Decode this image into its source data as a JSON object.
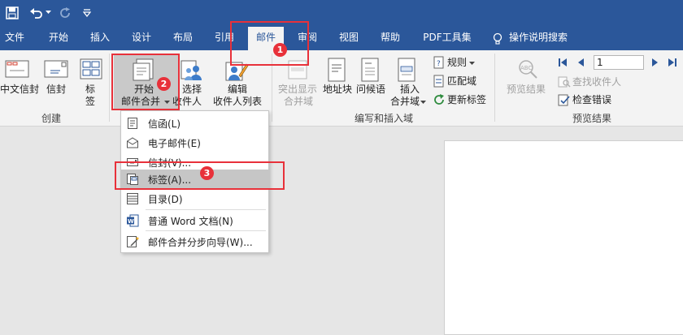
{
  "colors": {
    "brand": "#2b579a",
    "ribbon_bg": "#f3f3f3",
    "highlight": "#c6c6c6",
    "annotation_red": "#e8313a"
  },
  "tabs": [
    {
      "label": "文件"
    },
    {
      "label": "开始"
    },
    {
      "label": "插入"
    },
    {
      "label": "设计"
    },
    {
      "label": "布局"
    },
    {
      "label": "引用"
    },
    {
      "label": "邮件"
    },
    {
      "label": "审阅"
    },
    {
      "label": "视图"
    },
    {
      "label": "帮助"
    },
    {
      "label": "PDF工具集"
    },
    {
      "label": "操作说明搜索"
    }
  ],
  "active_tab": "邮件",
  "create_group": {
    "label": "创建",
    "chinese_envelope": "中文信封",
    "envelopes": "信封",
    "labels_line1": "标",
    "labels_line2": "签"
  },
  "start_group": {
    "start_line1": "开始",
    "start_line2": "邮件合并",
    "select_line1": "选择",
    "select_line2": "收件人",
    "edit_line1": "编辑",
    "edit_line2": "收件人列表"
  },
  "write_group": {
    "label": "编写和插入域",
    "highlight_line1": "突出显示",
    "highlight_line2": "合并域",
    "address_block": "地址块",
    "greeting_line": "问候语",
    "insert_line1": "插入",
    "insert_line2": "合并域",
    "rules": "规则",
    "match_fields": "匹配域",
    "update_labels": "更新标签"
  },
  "preview_group": {
    "label": "预览结果",
    "preview_results": "预览结果",
    "record_number": "1",
    "find_recipient": "查找收件人",
    "check_errors": "检查错误"
  },
  "dropdown": {
    "items": [
      {
        "label": "信函(L)",
        "icon": "letter-icon"
      },
      {
        "label": "电子邮件(E)",
        "icon": "email-icon"
      },
      {
        "label": "信封(V)...",
        "icon": "envelope-icon"
      },
      {
        "label": "标签(A)...",
        "icon": "label-icon"
      },
      {
        "label": "目录(D)",
        "icon": "directory-icon"
      },
      {
        "label": "普通 Word 文档(N)",
        "icon": "word-icon"
      },
      {
        "label": "邮件合并分步向导(W)...",
        "icon": "wizard-icon"
      }
    ]
  },
  "annotations": {
    "badge1": "1",
    "badge2": "2",
    "badge3": "3"
  }
}
